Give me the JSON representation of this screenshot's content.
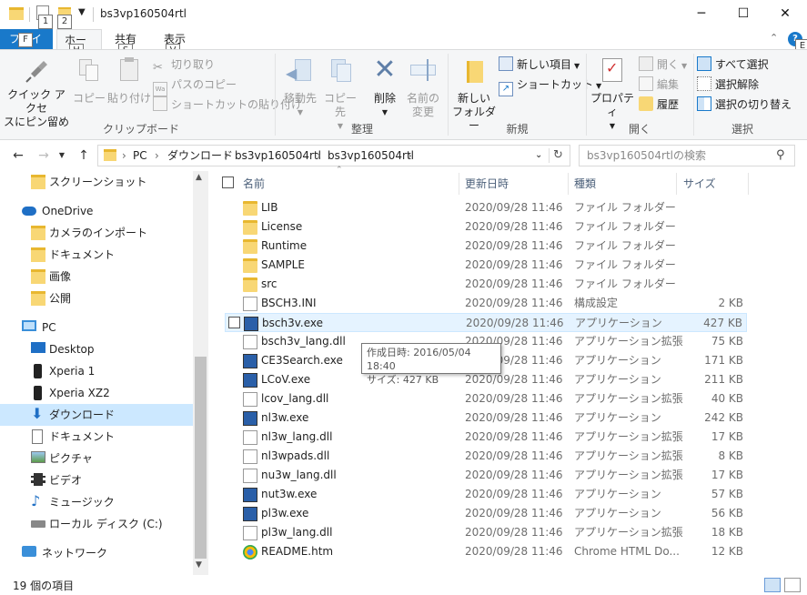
{
  "window": {
    "title": "bs3vp160504rtl",
    "quick_access_keytips": [
      "1",
      "2"
    ],
    "controls": {
      "minimize": "─",
      "maximize": "☐",
      "close": "✕"
    }
  },
  "ribbon_tabs": {
    "file": "ファイル",
    "file_keytip": "F",
    "home": "ホーム",
    "home_keytip": "H",
    "share": "共有",
    "share_keytip": "S",
    "view": "表示",
    "view_keytip": "V",
    "help_keytip": "E"
  },
  "ribbon": {
    "clipboard": {
      "label": "クリップボード",
      "pin_line1": "クイック アクセ",
      "pin_line2": "スにピン留め",
      "copy": "コピー",
      "paste": "貼り付け",
      "cut": "切り取り",
      "copy_path": "パスのコピー",
      "paste_shortcut": "ショートカットの貼り付け"
    },
    "organize": {
      "label": "整理",
      "move_to": "移動先",
      "copy_to": "コピー先",
      "delete": "削除",
      "rename_line1": "名前の",
      "rename_line2": "変更"
    },
    "new": {
      "label": "新規",
      "new_folder_line1": "新しい",
      "new_folder_line2": "フォルダー",
      "new_item": "新しい項目",
      "shortcut": "ショートカット"
    },
    "open": {
      "label": "開く",
      "properties": "プロパティ",
      "open": "開く",
      "edit": "編集",
      "history": "履歴"
    },
    "select": {
      "label": "選択",
      "select_all": "すべて選択",
      "select_none": "選択解除",
      "invert": "選択の切り替え"
    }
  },
  "address_bar": {
    "crumbs": [
      "PC",
      "ダウンロード",
      "bs3vp160504rtl",
      "bs3vp160504rtl"
    ],
    "search_placeholder": "bs3vp160504rtlの検索"
  },
  "nav": [
    {
      "label": "スクリーンショット",
      "icon": "folder-icon"
    },
    {
      "label": "OneDrive",
      "icon": "cloud-icon"
    },
    {
      "label": "カメラのインポート",
      "icon": "folder-icon"
    },
    {
      "label": "ドキュメント",
      "icon": "folder-icon"
    },
    {
      "label": "画像",
      "icon": "folder-icon"
    },
    {
      "label": "公開",
      "icon": "folder-icon"
    },
    {
      "label": "PC",
      "icon": "computer-icon"
    },
    {
      "label": "Desktop",
      "icon": "desktop-icon"
    },
    {
      "label": "Xperia 1",
      "icon": "phone-icon"
    },
    {
      "label": "Xperia XZ2",
      "icon": "phone-icon"
    },
    {
      "label": "ダウンロード",
      "icon": "download-icon"
    },
    {
      "label": "ドキュメント",
      "icon": "document-icon"
    },
    {
      "label": "ピクチャ",
      "icon": "pictures-icon"
    },
    {
      "label": "ビデオ",
      "icon": "video-icon"
    },
    {
      "label": "ミュージック",
      "icon": "music-icon"
    },
    {
      "label": "ローカル ディスク (C:)",
      "icon": "drive-icon"
    },
    {
      "label": "ネットワーク",
      "icon": "network-icon"
    }
  ],
  "columns": {
    "name": "名前",
    "date": "更新日時",
    "type": "種類",
    "size": "サイズ"
  },
  "files": [
    {
      "name": "LIB",
      "date": "2020/09/28 11:46",
      "type": "ファイル フォルダー",
      "size": ""
    },
    {
      "name": "License",
      "date": "2020/09/28 11:46",
      "type": "ファイル フォルダー",
      "size": ""
    },
    {
      "name": "Runtime",
      "date": "2020/09/28 11:46",
      "type": "ファイル フォルダー",
      "size": ""
    },
    {
      "name": "SAMPLE",
      "date": "2020/09/28 11:46",
      "type": "ファイル フォルダー",
      "size": ""
    },
    {
      "name": "src",
      "date": "2020/09/28 11:46",
      "type": "ファイル フォルダー",
      "size": ""
    },
    {
      "name": "BSCH3.INI",
      "date": "2020/09/28 11:46",
      "type": "構成設定",
      "size": "2 KB"
    },
    {
      "name": "bsch3v.exe",
      "date": "2020/09/28 11:46",
      "type": "アプリケーション",
      "size": "427 KB"
    },
    {
      "name": "bsch3v_lang.dll",
      "date": "2020/09/28 11:46",
      "type": "アプリケーション拡張",
      "size": "75 KB"
    },
    {
      "name": "CE3Search.exe",
      "date": "2020/09/28 11:46",
      "type": "アプリケーション",
      "size": "171 KB"
    },
    {
      "name": "LCoV.exe",
      "date": "2020/09/28 11:46",
      "type": "アプリケーション",
      "size": "211 KB"
    },
    {
      "name": "lcov_lang.dll",
      "date": "2020/09/28 11:46",
      "type": "アプリケーション拡張",
      "size": "40 KB"
    },
    {
      "name": "nl3w.exe",
      "date": "2020/09/28 11:46",
      "type": "アプリケーション",
      "size": "242 KB"
    },
    {
      "name": "nl3w_lang.dll",
      "date": "2020/09/28 11:46",
      "type": "アプリケーション拡張",
      "size": "17 KB"
    },
    {
      "name": "nl3wpads.dll",
      "date": "2020/09/28 11:46",
      "type": "アプリケーション拡張",
      "size": "8 KB"
    },
    {
      "name": "nu3w_lang.dll",
      "date": "2020/09/28 11:46",
      "type": "アプリケーション拡張",
      "size": "17 KB"
    },
    {
      "name": "nut3w.exe",
      "date": "2020/09/28 11:46",
      "type": "アプリケーション",
      "size": "57 KB"
    },
    {
      "name": "pl3w.exe",
      "date": "2020/09/28 11:46",
      "type": "アプリケーション",
      "size": "56 KB"
    },
    {
      "name": "pl3w_lang.dll",
      "date": "2020/09/28 11:46",
      "type": "アプリケーション拡張",
      "size": "18 KB"
    },
    {
      "name": "README.htm",
      "date": "2020/09/28 11:46",
      "type": "Chrome HTML Do...",
      "size": "12 KB"
    }
  ],
  "tooltip": {
    "line1": "作成日時: 2016/05/04 18:40",
    "line2": "サイズ: 427 KB"
  },
  "status": {
    "item_count": "19 個の項目"
  },
  "colors": {
    "accent": "#1979ca",
    "selection": "#cce8ff",
    "hover": "#e5f3ff",
    "folder": "#f8d775"
  }
}
